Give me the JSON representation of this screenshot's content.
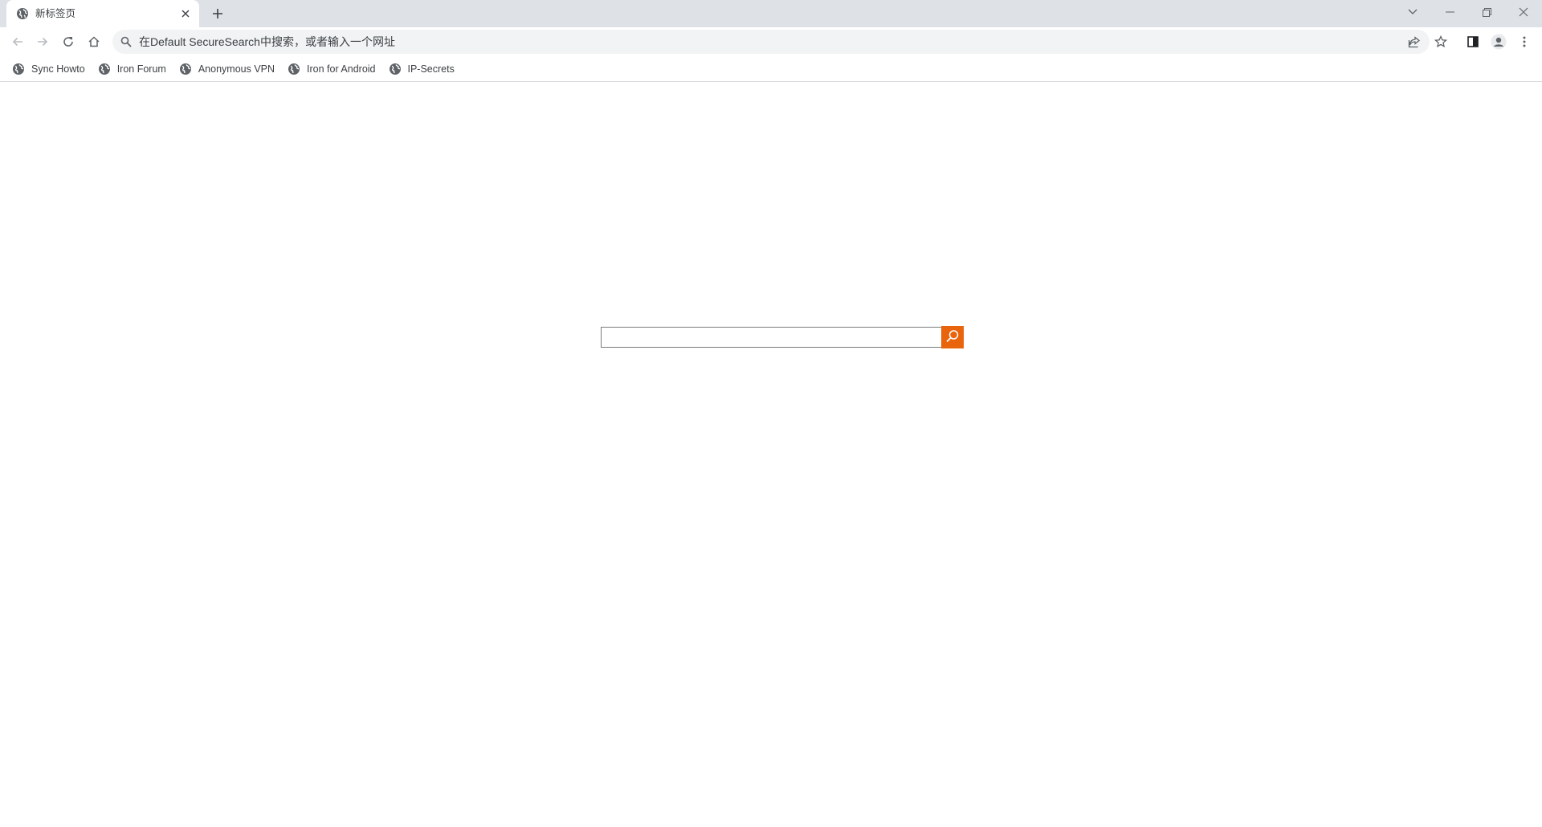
{
  "browser": {
    "tab": {
      "title": "新标签页",
      "favicon": "globe-icon"
    },
    "new_tab_icon": "plus-icon",
    "window_controls": [
      "tab-search-icon",
      "minimize-icon",
      "restore-icon",
      "close-icon"
    ]
  },
  "toolbar": {
    "buttons": [
      "back-arrow-icon",
      "forward-arrow-icon",
      "reload-icon",
      "home-icon"
    ],
    "omnibox": {
      "placeholder": "在Default SecureSearch中搜索，或者输入一个网址",
      "value": ""
    },
    "right_icons": [
      "share-icon",
      "star-icon",
      "side-panel-icon",
      "profile-avatar-icon",
      "kebab-menu-icon"
    ]
  },
  "bookmarks": [
    {
      "label": "Sync Howto"
    },
    {
      "label": "Iron Forum"
    },
    {
      "label": "Anonymous VPN"
    },
    {
      "label": "Iron for Android"
    },
    {
      "label": "IP-Secrets"
    }
  ],
  "page": {
    "search_input_value": "",
    "search_button_icon": "magnifier-icon"
  },
  "colors": {
    "tabstrip_bg": "#dee1e6",
    "omnibox_bg": "#f1f3f4",
    "search_button": "#e8650e",
    "icon_gray": "#5f6368"
  }
}
